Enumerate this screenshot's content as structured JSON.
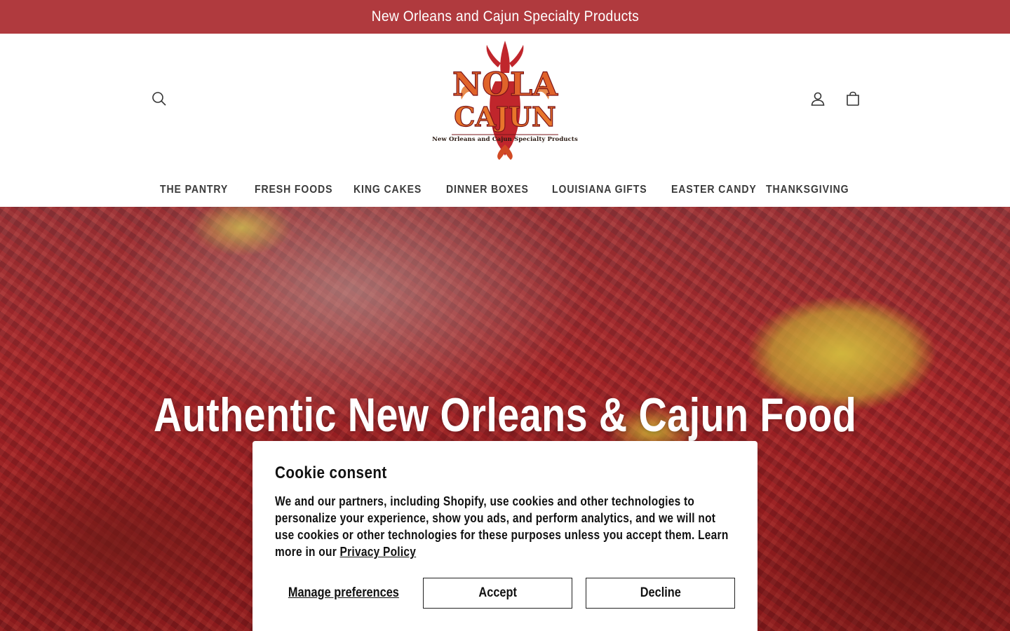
{
  "announcement": {
    "text": "New Orleans and Cajun Specialty Products"
  },
  "header": {
    "logo": {
      "line1": "NOLA",
      "line2": "CAJUN",
      "tagline": "New Orleans and Cajun Specialty Products"
    },
    "icons": {
      "search": "search-icon",
      "account": "account-icon",
      "cart": "cart-icon"
    }
  },
  "nav": {
    "items": [
      {
        "label": "THE PANTRY",
        "dropdown": true
      },
      {
        "label": "FRESH FOODS",
        "dropdown": true
      },
      {
        "label": "KING CAKES",
        "dropdown": true
      },
      {
        "label": "DINNER BOXES",
        "dropdown": true
      },
      {
        "label": "LOUISIANA GIFTS",
        "dropdown": true
      },
      {
        "label": "EASTER CANDY",
        "dropdown": false
      },
      {
        "label": "THANKSGIVING",
        "dropdown": true
      }
    ]
  },
  "hero": {
    "title": "Authentic New Orleans & Cajun Food"
  },
  "cookie": {
    "title": "Cookie consent",
    "body": "We and our partners, including Shopify, use cookies and other technologies to personalize your experience, show you ads, and perform analytics, and we will not use cookies or other technologies for these purposes unless you accept them. Learn more in our ",
    "link": "Privacy Policy",
    "manage": "Manage preferences",
    "accept": "Accept",
    "decline": "Decline"
  },
  "colors": {
    "announcement_bg": "#b03a3e",
    "text": "#111111"
  }
}
